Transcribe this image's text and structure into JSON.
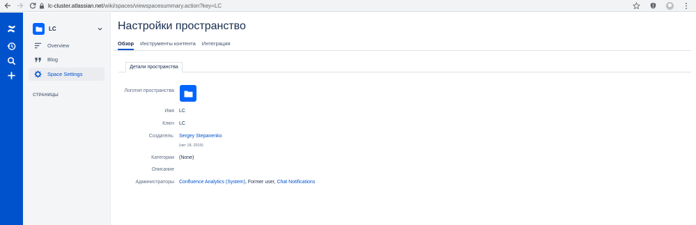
{
  "browser": {
    "url_host": "lc-cluster.atlassian.net",
    "url_path": "/wiki/spaces/viewspacesummary.action?key=LC"
  },
  "global_nav": {
    "icons": [
      "confluence-logo-icon",
      "history-icon",
      "search-icon",
      "create-icon"
    ]
  },
  "sidebar": {
    "space_name": "LC",
    "items": [
      {
        "label": "Overview",
        "icon": "overview-icon"
      },
      {
        "label": "Blog",
        "icon": "quote-icon"
      },
      {
        "label": "Space Settings",
        "icon": "gear-icon"
      }
    ],
    "pages_heading": "СТРАНИЦЫ"
  },
  "main": {
    "title": "Настройки пространство",
    "tabs": [
      {
        "label": "Обзор"
      },
      {
        "label": "Инструменты контента"
      },
      {
        "label": "Интеграция"
      }
    ],
    "sub_tab": "Детали пространства",
    "details": {
      "logo_label": "Логотип пространства",
      "name_label": "Имя",
      "name_value": "LC",
      "key_label": "Ключ",
      "key_value": "LC",
      "creator_label": "Создатель:",
      "creator_value": "Sergey Stepanenko",
      "creator_date": "(окт 18, 2019)",
      "categories_label": "Категории",
      "categories_value": "(None)",
      "description_label": "Описание",
      "admins_label": "Администраторы",
      "admin_1": "Confluence Analytics (System)",
      "admin_sep_1": ", Former user, ",
      "admin_2": "Chat Notifications"
    }
  },
  "colors": {
    "nav_blue": "#0052cc",
    "logo_blue": "#0065ff",
    "link": "#0052cc",
    "sidebar_bg": "#f4f5f7"
  }
}
